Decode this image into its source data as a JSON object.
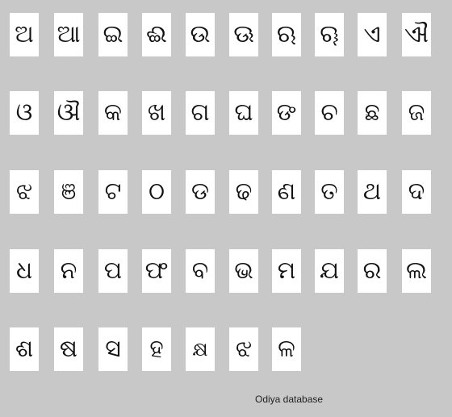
{
  "rows": [
    [
      "ଅ",
      "ଆ",
      "ଇ",
      "ଈ",
      "ଉ",
      "ଊ",
      "ଋ",
      "ୠ",
      "ଏ",
      "ଐ"
    ],
    [
      "ଓ",
      "ଔ",
      "କ",
      "ଖ",
      "ଗ",
      "ଘ",
      "ଙ",
      "ଚ",
      "ଛ",
      "ଜ"
    ],
    [
      "ଝ",
      "ଞ",
      "ଟ",
      "ଠ",
      "ଡ",
      "ଢ",
      "ଣ",
      "ତ",
      "ଥ",
      "ଦ"
    ],
    [
      "ଧ",
      "ନ",
      "ପ",
      "ଫ",
      "ବ",
      "ଭ",
      "ମ",
      "ଯ",
      "ର",
      "ଲ"
    ],
    [
      "ଶ",
      "ଷ",
      "ସ",
      "ହ",
      "କ୍ଷ",
      "ଝ",
      "ଳ"
    ]
  ],
  "caption": "Odiya database"
}
